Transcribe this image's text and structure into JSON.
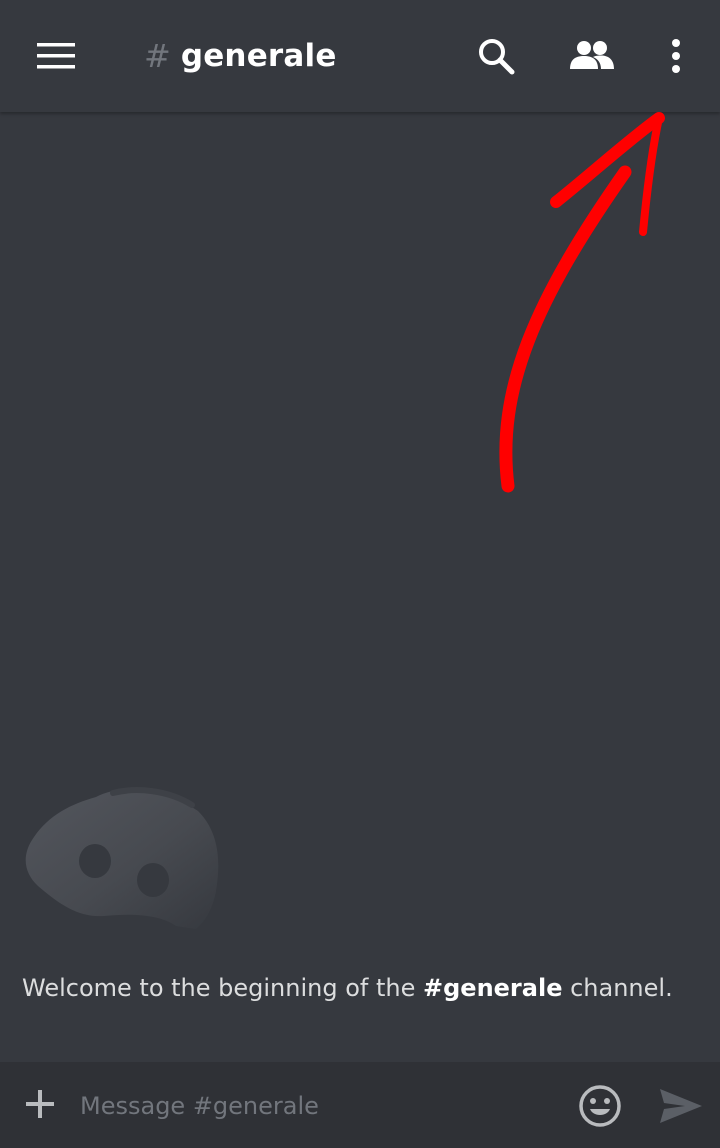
{
  "header": {
    "channel_hash": "#",
    "channel_name": "generale"
  },
  "welcome": {
    "prefix": "Welcome to the beginning of the ",
    "channel": "#generale",
    "suffix": " channel."
  },
  "composer": {
    "placeholder": "Message #generale"
  },
  "colors": {
    "background": "#36393f",
    "composer_background": "#2f3136",
    "annotation_arrow": "#ff0000",
    "text_primary": "#ffffff",
    "text_muted": "#72767d"
  },
  "icons": {
    "menu": "hamburger-menu-icon",
    "search": "search-icon",
    "members": "members-icon",
    "more": "more-vertical-icon",
    "add": "plus-icon",
    "emoji": "emoji-icon",
    "send": "send-icon"
  }
}
